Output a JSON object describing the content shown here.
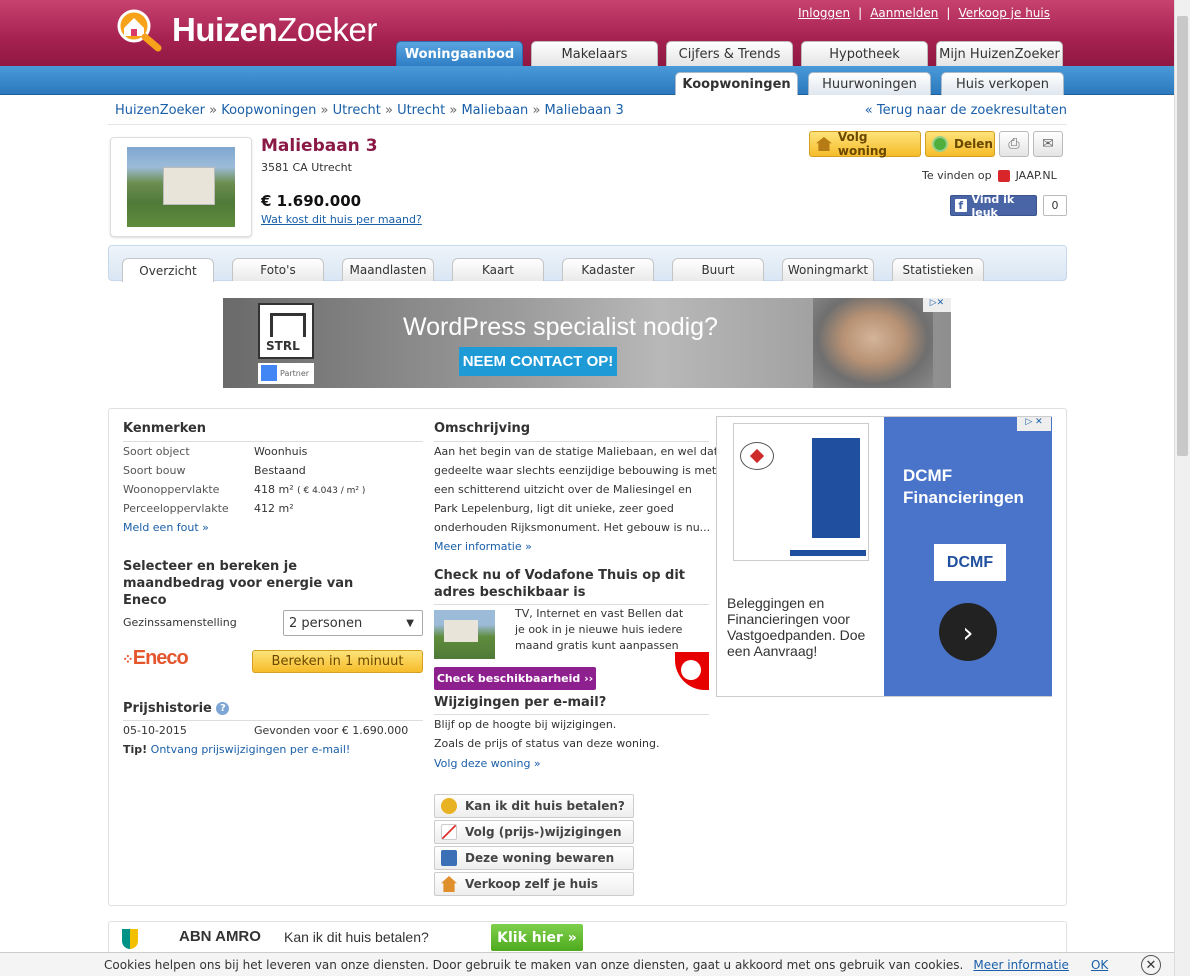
{
  "header": {
    "logo_text_bold": "Huizen",
    "logo_text_light": "Zoeker",
    "top_links": [
      "Inloggen",
      "Aanmelden",
      "Verkoop je huis"
    ],
    "top_sep": "|",
    "main_tabs": [
      "Woningaanbod",
      "Makelaars",
      "Cijfers & Trends",
      "Hypotheek",
      "Mijn HuizenZoeker"
    ],
    "sub_tabs": [
      "Koopwoningen",
      "Huurwoningen",
      "Huis verkopen"
    ]
  },
  "breadcrumb": {
    "items": [
      "HuizenZoeker",
      "Koopwoningen",
      "Utrecht",
      "Utrecht",
      "Maliebaan",
      "Maliebaan 3"
    ],
    "sep": "»",
    "back": "« Terug naar de zoekresultaten"
  },
  "property": {
    "title": "Maliebaan 3",
    "address": "3581 CA Utrecht",
    "price": "€ 1.690.000",
    "monthly_link": "Wat kost dit huis per maand?",
    "follow_label": "Volg woning",
    "share_label": "Delen",
    "found_on_label": "Te vinden op",
    "found_on_site": "JAAP.NL",
    "fb_label": "Vind ik leuk",
    "fb_count": "0"
  },
  "tabs": [
    "Overzicht",
    "Foto's",
    "Maandlasten",
    "Kaart",
    "Kadaster",
    "Buurt",
    "Woningmarkt",
    "Statistieken"
  ],
  "banner_ad": {
    "logo": "STRL",
    "partner": "Partner",
    "headline": "WordPress specialist nodig?",
    "cta": "NEEM CONTACT OP!"
  },
  "kenmerken": {
    "title": "Kenmerken",
    "rows": [
      {
        "label": "Soort object",
        "value": "Woonhuis"
      },
      {
        "label": "Soort bouw",
        "value": "Bestaand"
      },
      {
        "label": "Woonoppervlakte",
        "value": "418 m²",
        "extra": "( € 4.043 / m² )"
      },
      {
        "label": "Perceeloppervlakte",
        "value": "412 m²"
      }
    ],
    "report": "Meld een fout »"
  },
  "energie": {
    "title": "Selecteer en bereken je maandbedrag voor energie van Eneco",
    "household_label": "Gezinssamenstelling",
    "household_value": "2 personen",
    "brand": "Eneco",
    "button": "Bereken in 1 minuut"
  },
  "prijshistorie": {
    "title": "Prijshistorie",
    "date": "05-10-2015",
    "event": "Gevonden voor € 1.690.000",
    "tip_label": "Tip!",
    "tip_link": "Ontvang prijswijzigingen per e-mail!"
  },
  "omschrijving": {
    "title": "Omschrijving",
    "lines": [
      "Aan het begin van de statige Maliebaan, en wel dat",
      "gedeelte waar slechts eenzijdige bebouwing is met",
      "een schitterend uitzicht over de Maliesingel en",
      "Park Lepelenburg, ligt dit unieke, zeer goed",
      "onderhouden Rijksmonument. Het gebouw is nu..."
    ],
    "more": "Meer informatie »"
  },
  "vodafone": {
    "title": "Check nu of Vodafone Thuis op dit adres beschikbaar is",
    "lines": [
      "TV, Internet en vast Bellen dat",
      "je ook in je nieuwe huis iedere",
      "maand gratis kunt aanpassen"
    ],
    "button": "Check beschikbaarheid ››"
  },
  "wijzigingen": {
    "title": "Wijzigingen per e-mail?",
    "lines": [
      "Blijf op de hoogte bij wijzigingen.",
      "Zoals de prijs of status van deze woning."
    ],
    "link": "Volg deze woning »"
  },
  "actions": [
    "Kan ik dit huis betalen?",
    "Volg (prijs-)wijzigingen",
    "Deze woning bewaren",
    "Verkoop zelf je huis"
  ],
  "side_ad": {
    "text": "Beleggingen en Financieringen voor Vastgoedpanden. Doe een Aanvraag!",
    "headline_1": "DCMF",
    "headline_2": "Financieringen",
    "logo": "DCMF"
  },
  "abn": {
    "name": "ABN AMRO",
    "question": "Kan ik dit huis betalen?",
    "button": "Klik hier »"
  },
  "cookie": {
    "text": "Cookies helpen ons bij het leveren van onze diensten. Door gebruik te maken van onze diensten, gaat u akkoord met ons gebruik van cookies.",
    "more": "Meer informatie",
    "ok": "OK"
  }
}
